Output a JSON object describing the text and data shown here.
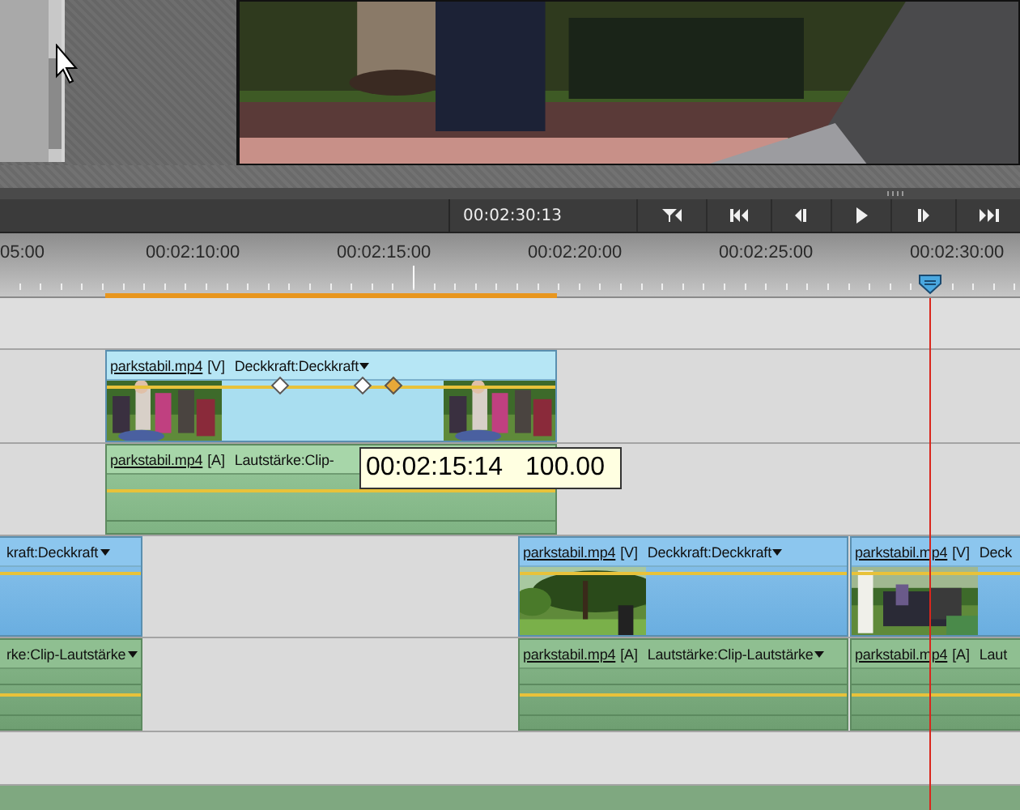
{
  "transport": {
    "timecode": "00:02:30:13",
    "buttons": [
      {
        "kind": "trim"
      },
      {
        "kind": "start"
      },
      {
        "kind": "back"
      },
      {
        "kind": "play"
      },
      {
        "kind": "forward"
      },
      {
        "kind": "end"
      }
    ]
  },
  "ruler": {
    "labels": [
      "05:00",
      "00:02:10:00",
      "00:02:15:00",
      "00:02:20:00",
      "00:02:25:00",
      "00:02:30:00"
    ]
  },
  "tracks": [
    {
      "kind": "empty"
    },
    {
      "kind": "video",
      "clips": [
        {
          "file": "parkstabil.mp4",
          "tag": "[V]",
          "effect": "Deckkraft:Deckkraft",
          "dropdown": true,
          "selected": true,
          "keyframes": [
            {
              "selected": false
            },
            {
              "selected": false
            },
            {
              "selected": true
            }
          ]
        }
      ]
    },
    {
      "kind": "audio",
      "clips": [
        {
          "file": "parkstabil.mp4",
          "tag": "[A]",
          "effect": "Lautstärke:Clip-",
          "dropdown": false,
          "selected": true
        }
      ]
    },
    {
      "kind": "video",
      "clips": [
        {
          "effect": "kraft:Deckkraft",
          "dropdown": true,
          "selected": false
        },
        {
          "file": "parkstabil.mp4",
          "tag": "[V]",
          "effect": "Deckkraft:Deckkraft",
          "dropdown": true,
          "selected": false
        },
        {
          "file": "parkstabil.mp4",
          "tag": "[V]",
          "effect": "Deck",
          "dropdown": false,
          "selected": false
        }
      ]
    },
    {
      "kind": "audio",
      "clips": [
        {
          "effect": "rke:Clip-Lautstärke",
          "dropdown": true,
          "selected": false
        },
        {
          "file": "parkstabil.mp4",
          "tag": "[A]",
          "effect": "Lautstärke:Clip-Lautstärke",
          "dropdown": true,
          "selected": false
        },
        {
          "file": "parkstabil.mp4",
          "tag": "[A]",
          "effect": "Laut",
          "dropdown": false,
          "selected": false
        }
      ]
    },
    {
      "kind": "empty"
    }
  ],
  "tooltip": {
    "time": "00:02:15:14",
    "value": "100.00"
  }
}
